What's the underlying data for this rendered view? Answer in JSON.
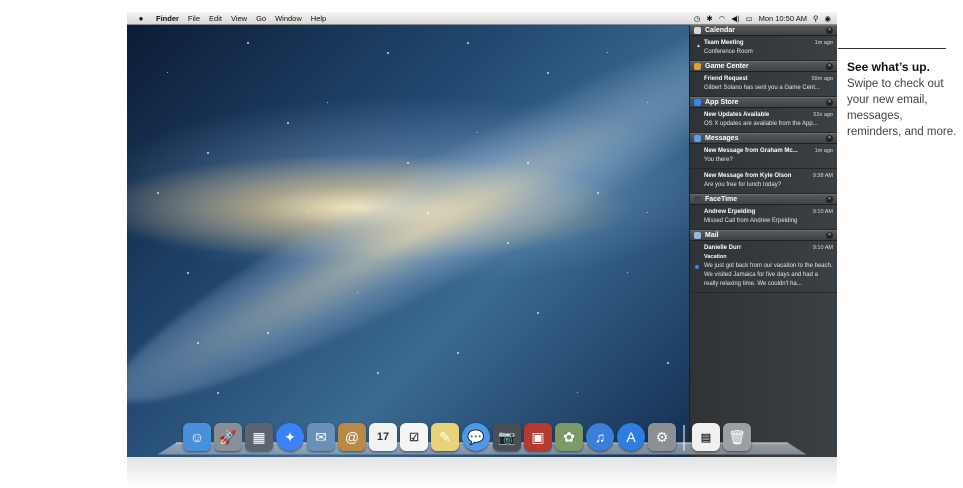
{
  "menubar": {
    "apple": "",
    "items": [
      "Finder",
      "File",
      "Edit",
      "View",
      "Go",
      "Window",
      "Help"
    ],
    "clock": "Mon 10:50 AM"
  },
  "notifications": [
    {
      "app": "Calendar",
      "icon_color": "#d9d9d9",
      "items": [
        {
          "title": "Team Meeting",
          "time": "1m ago",
          "body": "Conference Room",
          "flag": "▲"
        }
      ]
    },
    {
      "app": "Game Center",
      "icon_color": "#e0a030",
      "items": [
        {
          "title": "Friend Request",
          "time": "59m ago",
          "body": "Gilbert Solano has sent you a Game Cent..."
        }
      ]
    },
    {
      "app": "App Store",
      "icon_color": "#3b82f6",
      "items": [
        {
          "title": "New Updates Available",
          "time": "52s ago",
          "body": "OS X updates are available from the App..."
        }
      ]
    },
    {
      "app": "Messages",
      "icon_color": "#5aa0e8",
      "items": [
        {
          "title": "New Message from Graham Mc...",
          "time": "1m ago",
          "body": "You there?"
        },
        {
          "title": "New Message from Kyle Olson",
          "time": "9:38 AM",
          "body": "Are you free for lunch today?"
        }
      ]
    },
    {
      "app": "FaceTime",
      "icon_color": "#444",
      "items": [
        {
          "title": "Andrew Erpelding",
          "time": "9:10 AM",
          "body": "Missed Call from Andrew Erpelding"
        }
      ]
    },
    {
      "app": "Mail",
      "icon_color": "#9ab8d8",
      "items": [
        {
          "title": "Danielle Durr",
          "time": "9:10 AM",
          "sub": "Vacation",
          "body": "We just got back from our vacation to the beach.  We visited Jamaica for five days and had a really relaxing time.  We couldn't ha...",
          "unread": true
        }
      ]
    }
  ],
  "dock": [
    {
      "name": "finder",
      "color": "#4a90d9",
      "glyph": "☺"
    },
    {
      "name": "launchpad",
      "color": "#8a8f96",
      "glyph": "🚀"
    },
    {
      "name": "mission-control",
      "color": "#5b6470",
      "glyph": "▦"
    },
    {
      "name": "safari",
      "color": "#3b82f6",
      "glyph": "✦"
    },
    {
      "name": "mail",
      "color": "#6a8fb8",
      "glyph": "✉"
    },
    {
      "name": "contacts",
      "color": "#b88a4a",
      "glyph": "@"
    },
    {
      "name": "calendar",
      "color": "#f2f2f2",
      "glyph": "17"
    },
    {
      "name": "reminders",
      "color": "#f5f5f5",
      "glyph": "☑"
    },
    {
      "name": "notes",
      "color": "#e8d27a",
      "glyph": "✎"
    },
    {
      "name": "messages",
      "color": "#4a9ae8",
      "glyph": "💬"
    },
    {
      "name": "facetime",
      "color": "#4a4f55",
      "glyph": "📷"
    },
    {
      "name": "photo-booth",
      "color": "#b33a2e",
      "glyph": "▣"
    },
    {
      "name": "iphoto",
      "color": "#7a9a6a",
      "glyph": "✿"
    },
    {
      "name": "itunes",
      "color": "#3a7fd8",
      "glyph": "♫"
    },
    {
      "name": "app-store",
      "color": "#2f7de0",
      "glyph": "A"
    },
    {
      "name": "system-preferences",
      "color": "#8c9096",
      "glyph": "⚙"
    },
    {
      "name": "pages-document",
      "color": "#f0f0f0",
      "glyph": "▤"
    },
    {
      "name": "trash",
      "color": "#9aa0a6",
      "glyph": "🗑"
    }
  ],
  "callout": {
    "title": "See what’s up.",
    "body": "Swipe to check out your new email, messages, reminders, and more."
  }
}
